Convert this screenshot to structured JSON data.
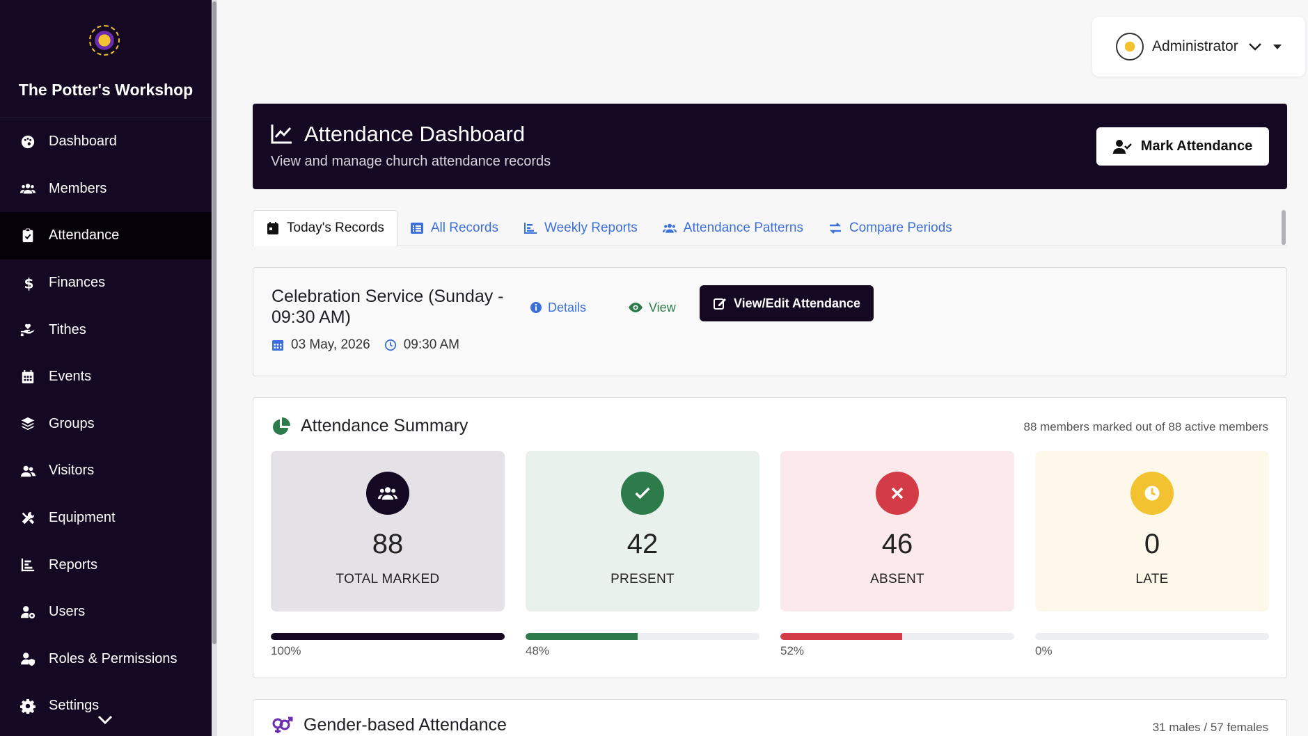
{
  "brand": {
    "title": "The Potter's Workshop"
  },
  "sidebar": {
    "items": [
      {
        "label": "Dashboard",
        "icon": "palette-icon"
      },
      {
        "label": "Members",
        "icon": "users-icon"
      },
      {
        "label": "Attendance",
        "icon": "clipboard-check-icon",
        "active": true
      },
      {
        "label": "Finances",
        "icon": "dollar-icon"
      },
      {
        "label": "Tithes",
        "icon": "hand-holding-heart-icon"
      },
      {
        "label": "Events",
        "icon": "calendar-icon"
      },
      {
        "label": "Groups",
        "icon": "layers-icon"
      },
      {
        "label": "Visitors",
        "icon": "user-friends-icon"
      },
      {
        "label": "Equipment",
        "icon": "tools-icon"
      },
      {
        "label": "Reports",
        "icon": "chart-bar-icon"
      },
      {
        "label": "Users",
        "icon": "user-cog-icon"
      },
      {
        "label": "Roles & Permissions",
        "icon": "user-shield-icon"
      },
      {
        "label": "Settings",
        "icon": "gear-icon"
      }
    ]
  },
  "user": {
    "name": "Administrator"
  },
  "header": {
    "title": "Attendance Dashboard",
    "subtitle": "View and manage church attendance records",
    "mark_button": "Mark Attendance"
  },
  "tabs": [
    {
      "label": "Today's Records",
      "active": true
    },
    {
      "label": "All Records"
    },
    {
      "label": "Weekly Reports"
    },
    {
      "label": "Attendance Patterns"
    },
    {
      "label": "Compare Periods"
    }
  ],
  "service": {
    "title": "Celebration Service (Sunday - 09:30 AM)",
    "date": "03 May, 2026",
    "time": "09:30 AM",
    "details_label": "Details",
    "view_label": "View",
    "edit_label": "View/Edit Attendance"
  },
  "summary": {
    "title": "Attendance Summary",
    "meta": "88 members marked out of 88 active members",
    "stats": [
      {
        "value": "88",
        "label": "TOTAL MARKED",
        "pct_label": "100%",
        "pct": 100,
        "color": "#150822",
        "bg": "#e4e2e6"
      },
      {
        "value": "42",
        "label": "PRESENT",
        "pct_label": "48%",
        "pct": 48,
        "color": "#2d7a4b",
        "bg": "#e9f1ec"
      },
      {
        "value": "46",
        "label": "ABSENT",
        "pct_label": "52%",
        "pct": 52,
        "color": "#d33b47",
        "bg": "#fbe9eb"
      },
      {
        "value": "0",
        "label": "LATE",
        "pct_label": "0%",
        "pct": 0,
        "color": "#f2c230",
        "bg": "#fdf8e9"
      }
    ]
  },
  "gender": {
    "title": "Gender-based Attendance",
    "meta": "31 males / 57 females"
  },
  "colors": {
    "primary": "#150822",
    "link": "#3b6fd9",
    "success": "#2d7a4b",
    "danger": "#d33b47",
    "warning": "#f2c230"
  }
}
